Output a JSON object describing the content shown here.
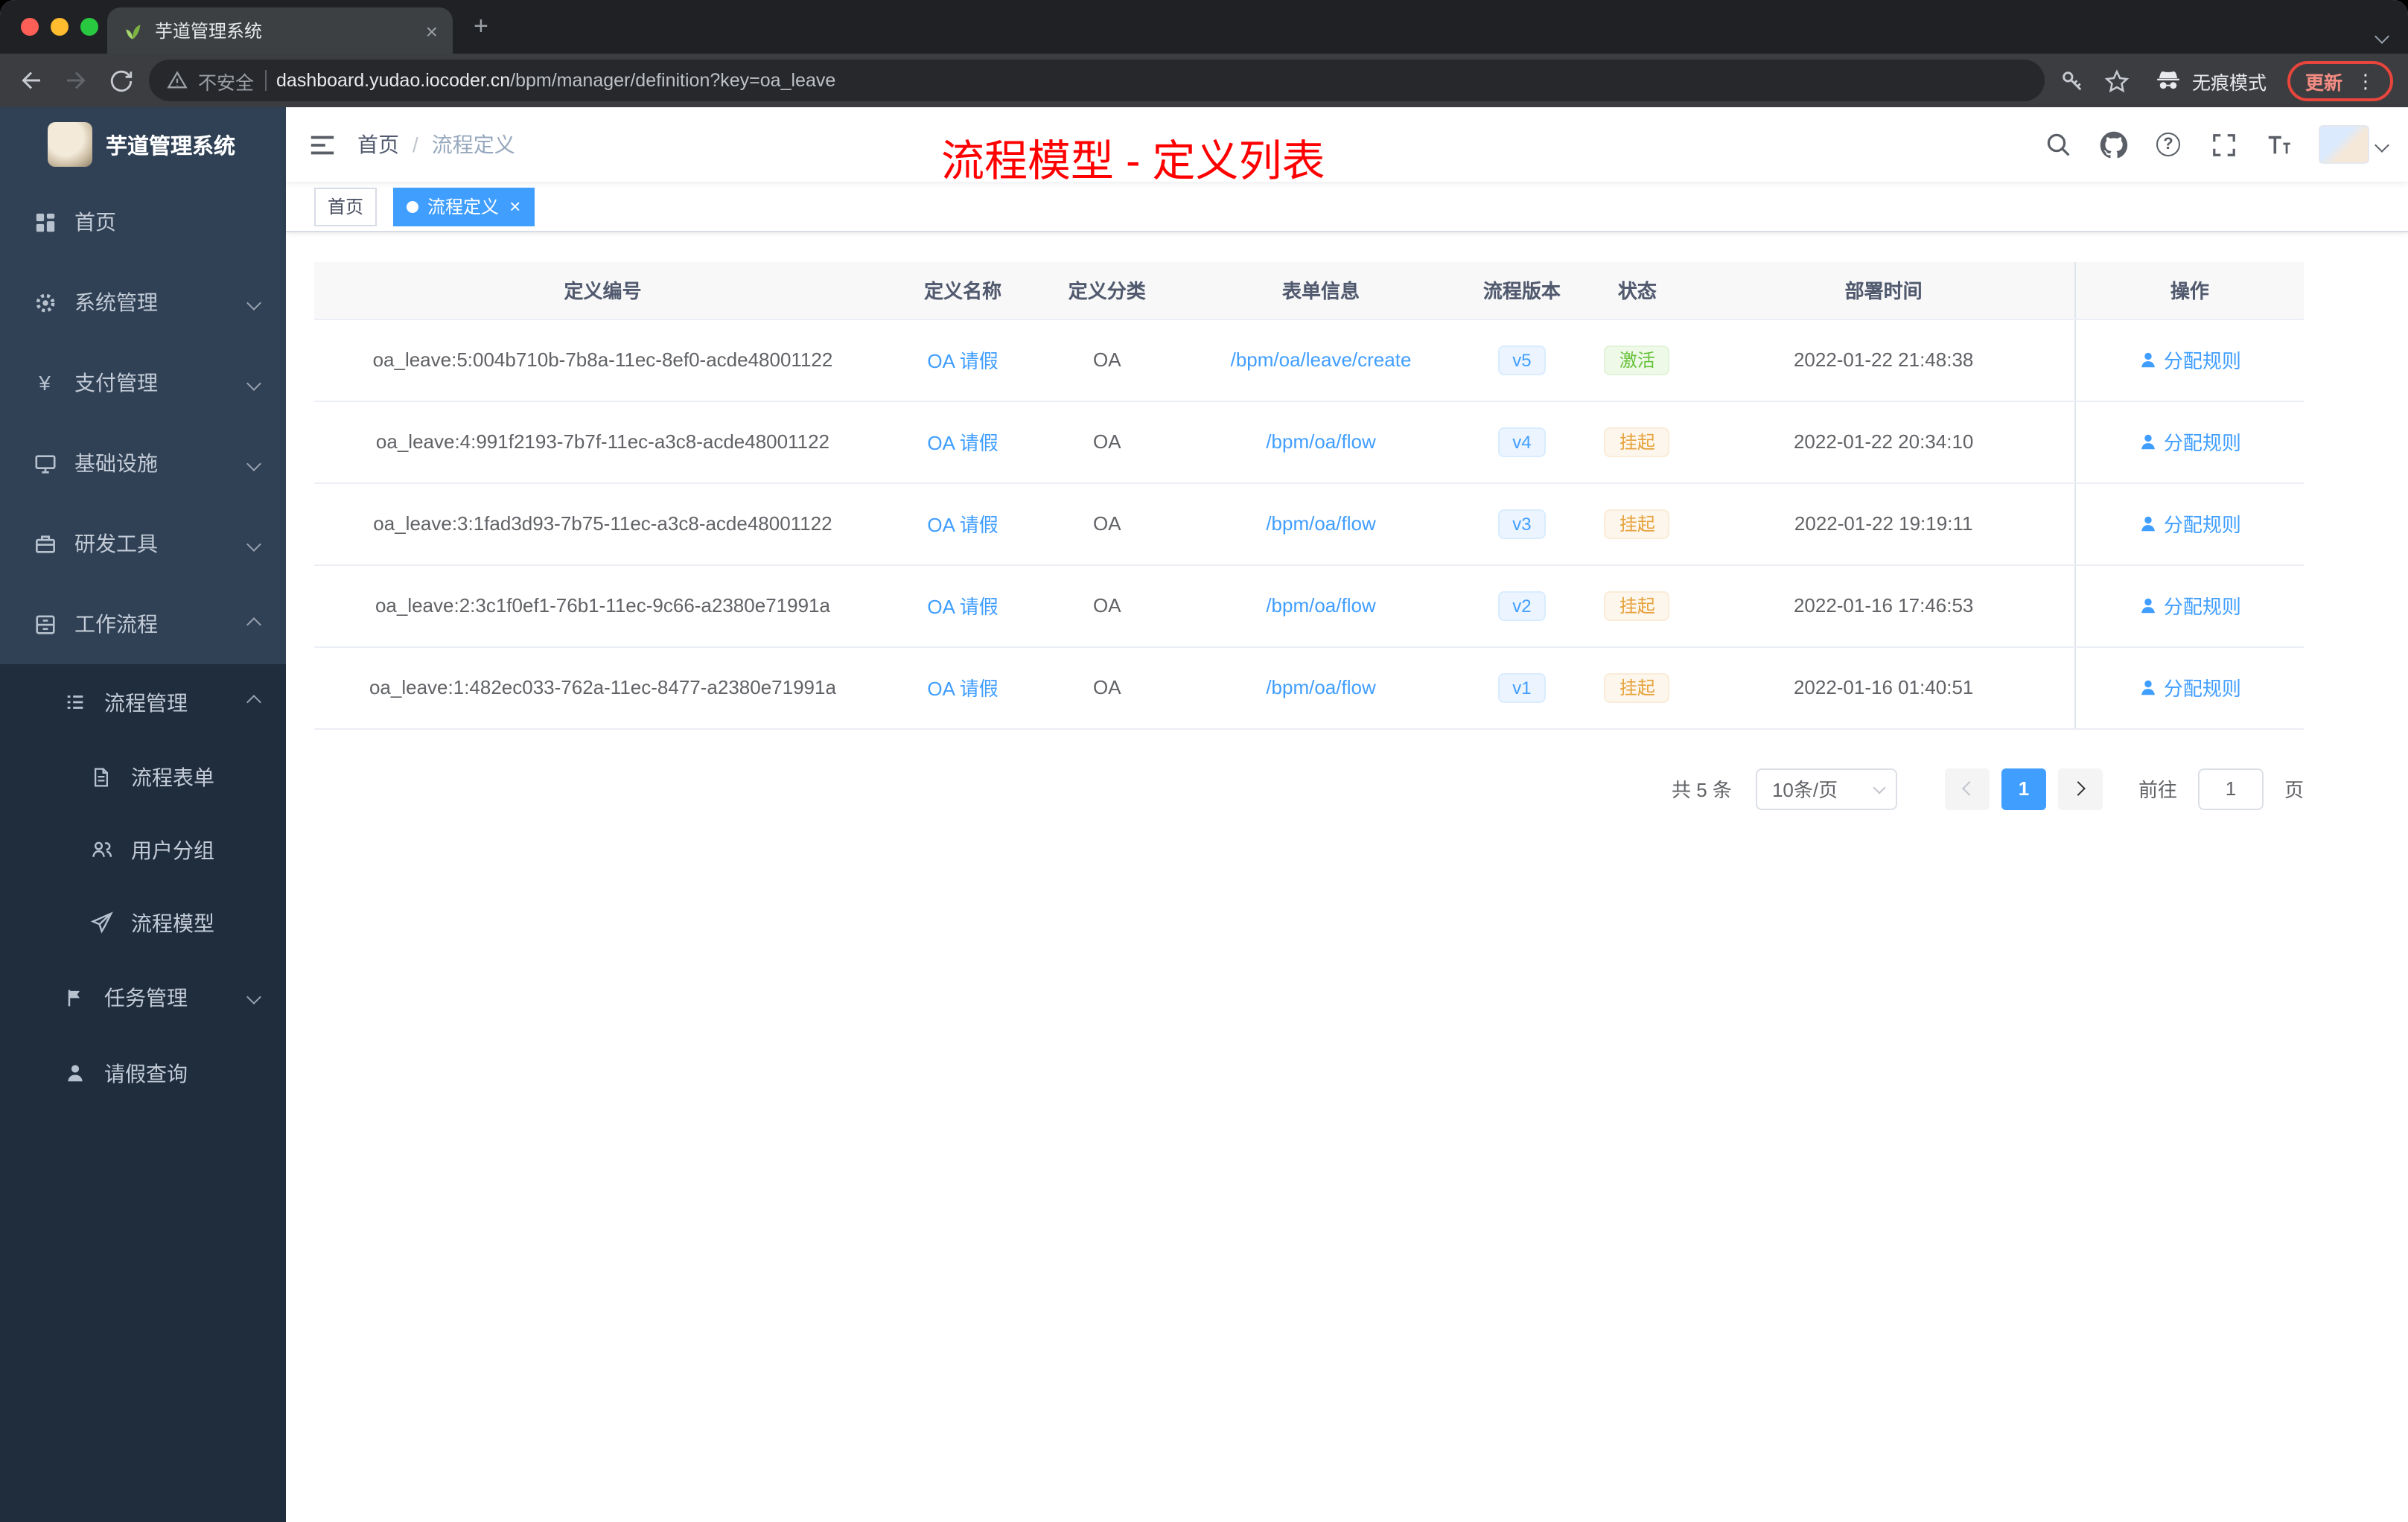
{
  "browser": {
    "tab_title": "芋道管理系统",
    "security_label": "不安全",
    "url_domain": "dashboard.yudao.iocoder.cn",
    "url_path": "/bpm/manager/definition?key=oa_leave",
    "incognito_label": "无痕模式",
    "update_label": "更新"
  },
  "glyphs": {
    "close": "×",
    "add_tab": "+",
    "more_menu": "⋮",
    "help": "?",
    "yen": "¥"
  },
  "sidebar": {
    "logo_title": "芋道管理系统",
    "items": [
      {
        "label": "首页"
      },
      {
        "label": "系统管理"
      },
      {
        "label": "支付管理"
      },
      {
        "label": "基础设施"
      },
      {
        "label": "研发工具"
      },
      {
        "label": "工作流程"
      },
      {
        "label": "流程管理"
      },
      {
        "label": "流程表单"
      },
      {
        "label": "用户分组"
      },
      {
        "label": "流程模型"
      },
      {
        "label": "任务管理"
      },
      {
        "label": "请假查询"
      }
    ]
  },
  "navbar": {
    "breadcrumb_home": "首页",
    "breadcrumb_separator": "/",
    "breadcrumb_current": "流程定义",
    "annotation": "流程模型 - 定义列表"
  },
  "tags_view": {
    "tags": [
      {
        "label": "首页"
      },
      {
        "label": "流程定义"
      }
    ]
  },
  "table": {
    "columns": {
      "id": "定义编号",
      "name": "定义名称",
      "category": "定义分类",
      "form": "表单信息",
      "version": "流程版本",
      "status": "状态",
      "deploy_time": "部署时间",
      "actions": "操作"
    },
    "rows": [
      {
        "id": "oa_leave:5:004b710b-7b8a-11ec-8ef0-acde48001122",
        "name": "OA 请假",
        "category": "OA",
        "form": "/bpm/oa/leave/create",
        "version": "v5",
        "status": "激活",
        "deploy_time": "2022-01-22 21:48:38",
        "action": "分配规则"
      },
      {
        "id": "oa_leave:4:991f2193-7b7f-11ec-a3c8-acde48001122",
        "name": "OA 请假",
        "category": "OA",
        "form": "/bpm/oa/flow",
        "version": "v4",
        "status": "挂起",
        "deploy_time": "2022-01-22 20:34:10",
        "action": "分配规则"
      },
      {
        "id": "oa_leave:3:1fad3d93-7b75-11ec-a3c8-acde48001122",
        "name": "OA 请假",
        "category": "OA",
        "form": "/bpm/oa/flow",
        "version": "v3",
        "status": "挂起",
        "deploy_time": "2022-01-22 19:19:11",
        "action": "分配规则"
      },
      {
        "id": "oa_leave:2:3c1f0ef1-76b1-11ec-9c66-a2380e71991a",
        "name": "OA 请假",
        "category": "OA",
        "form": "/bpm/oa/flow",
        "version": "v2",
        "status": "挂起",
        "deploy_time": "2022-01-16 17:46:53",
        "action": "分配规则"
      },
      {
        "id": "oa_leave:1:482ec033-762a-11ec-8477-a2380e71991a",
        "name": "OA 请假",
        "category": "OA",
        "form": "/bpm/oa/flow",
        "version": "v1",
        "status": "挂起",
        "deploy_time": "2022-01-16 01:40:51",
        "action": "分配规则"
      }
    ]
  },
  "pagination": {
    "total": "共 5 条",
    "page_size": "10条/页",
    "current_page": "1",
    "goto_label": "前往",
    "goto_value": "1",
    "page_unit": "页"
  },
  "colors": {
    "accent_blue": "#409eff",
    "status_active_green": "#67c23a",
    "status_suspended_orange": "#e6a23c",
    "sidebar_dark": "#1f2d3d",
    "sidebar_item": "#304156",
    "annotation_red": "#ff0000"
  }
}
